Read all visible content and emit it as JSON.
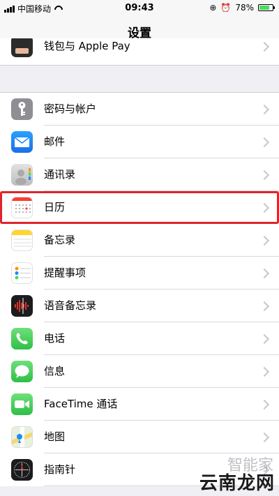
{
  "status_bar": {
    "carrier": "中国移动",
    "time": "09:43",
    "battery_percent": "78%",
    "battery_level": 0.78
  },
  "nav": {
    "title": "设置"
  },
  "top_row": {
    "label": "钱包与 Apple Pay"
  },
  "rows": [
    {
      "label": "密码与帐户",
      "icon": "key-icon",
      "color": "#8e8e93"
    },
    {
      "label": "邮件",
      "icon": "mail-icon",
      "color": "#1a8cff"
    },
    {
      "label": "通讯录",
      "icon": "contacts-icon",
      "color": "#c4c4c4"
    },
    {
      "label": "日历",
      "icon": "calendar-icon",
      "color": "#ffffff",
      "highlighted": true
    },
    {
      "label": "备忘录",
      "icon": "notes-icon",
      "color": "#ffd52e"
    },
    {
      "label": "提醒事项",
      "icon": "reminders-icon",
      "color": "#ffffff"
    },
    {
      "label": "语音备忘录",
      "icon": "voice-memos-icon",
      "color": "#1c1c1e"
    },
    {
      "label": "电话",
      "icon": "phone-icon",
      "color": "#4cd964"
    },
    {
      "label": "信息",
      "icon": "messages-icon",
      "color": "#4cd964"
    },
    {
      "label": "FaceTime 通话",
      "icon": "facetime-icon",
      "color": "#4cd964"
    },
    {
      "label": "地图",
      "icon": "maps-icon",
      "color": "#e8f0e0"
    },
    {
      "label": "指南针",
      "icon": "compass-icon",
      "color": "#1c1c1e"
    }
  ],
  "watermark": {
    "text": "云南龙网",
    "faint_text": "智能家"
  }
}
